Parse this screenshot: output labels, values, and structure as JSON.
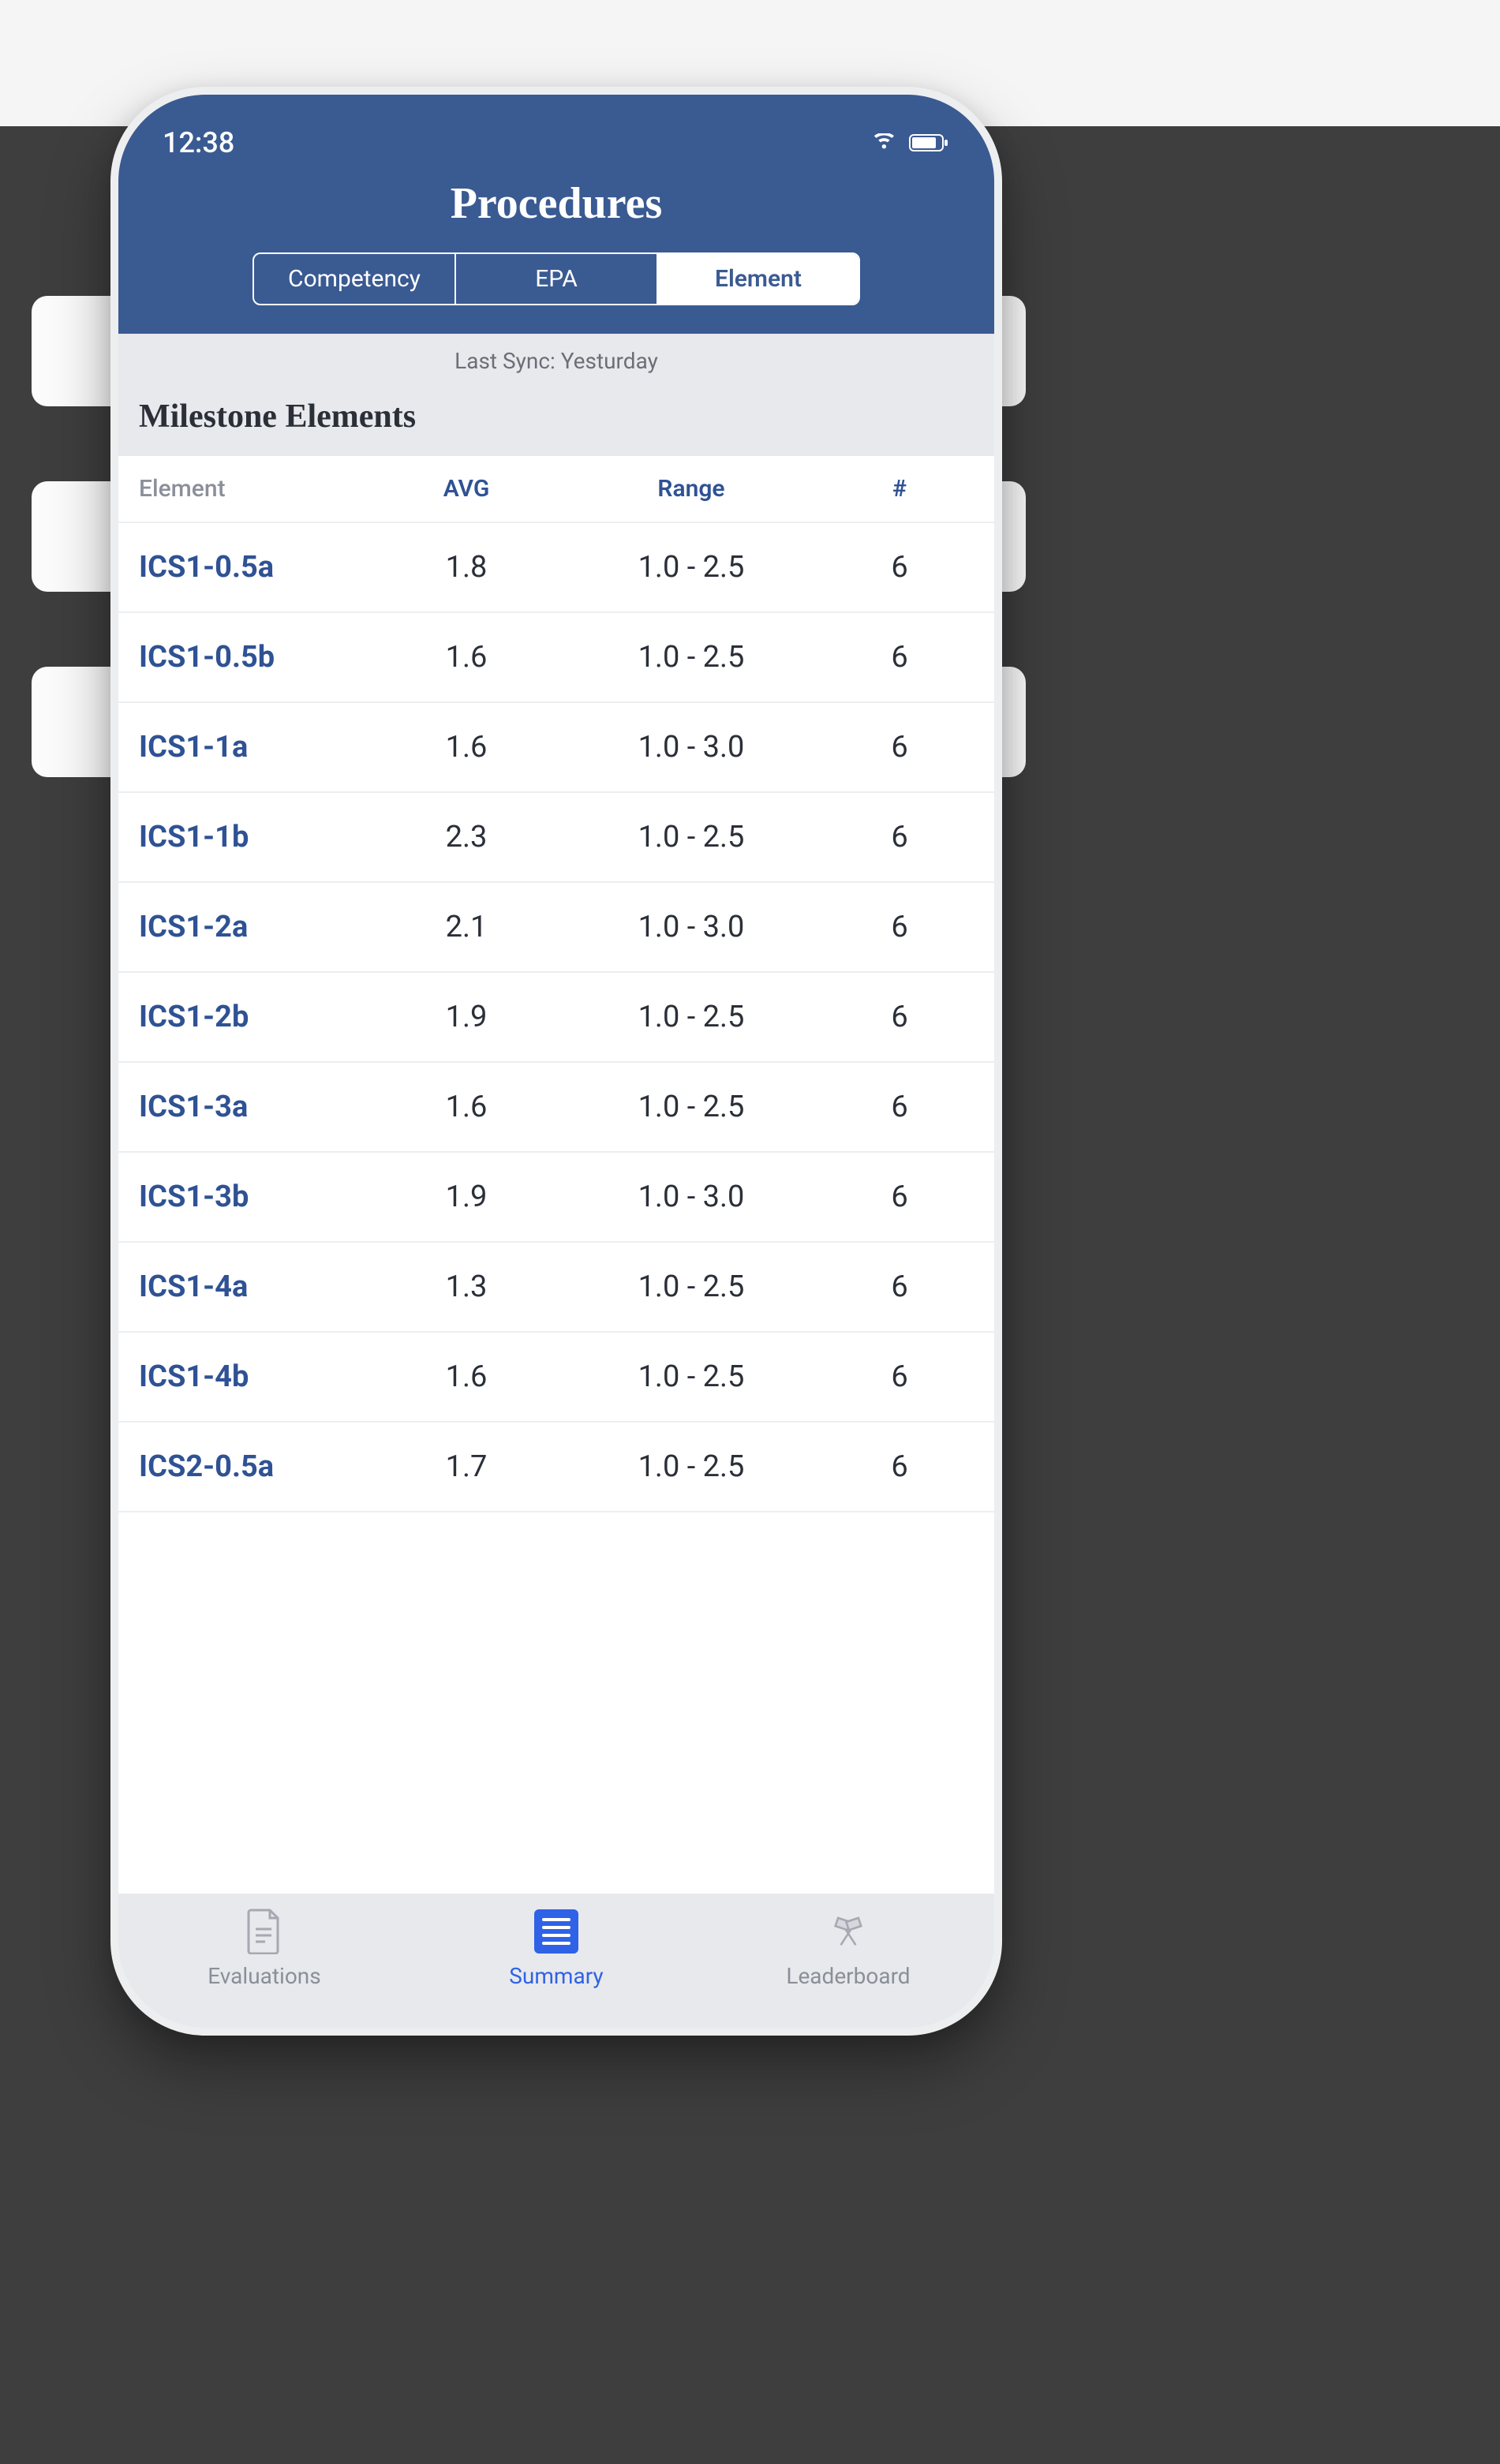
{
  "status": {
    "time": "12:38"
  },
  "header": {
    "title": "Procedures",
    "tabs": {
      "competency": "Competency",
      "epa": "EPA",
      "element": "Element"
    }
  },
  "sync": {
    "label": "Last Sync: Yesturday"
  },
  "section": {
    "title": "Milestone Elements"
  },
  "table": {
    "headers": {
      "element": "Element",
      "avg": "AVG",
      "range": "Range",
      "count": "#"
    },
    "rows": [
      {
        "element": "ICS1-0.5a",
        "avg": "1.8",
        "range": "1.0 - 2.5",
        "count": "6"
      },
      {
        "element": "ICS1-0.5b",
        "avg": "1.6",
        "range": "1.0 - 2.5",
        "count": "6"
      },
      {
        "element": "ICS1-1a",
        "avg": "1.6",
        "range": "1.0 - 3.0",
        "count": "6"
      },
      {
        "element": "ICS1-1b",
        "avg": "2.3",
        "range": "1.0 - 2.5",
        "count": "6"
      },
      {
        "element": "ICS1-2a",
        "avg": "2.1",
        "range": "1.0 - 3.0",
        "count": "6"
      },
      {
        "element": "ICS1-2b",
        "avg": "1.9",
        "range": "1.0 - 2.5",
        "count": "6"
      },
      {
        "element": "ICS1-3a",
        "avg": "1.6",
        "range": "1.0 - 2.5",
        "count": "6"
      },
      {
        "element": "ICS1-3b",
        "avg": "1.9",
        "range": "1.0 - 3.0",
        "count": "6"
      },
      {
        "element": "ICS1-4a",
        "avg": "1.3",
        "range": "1.0 - 2.5",
        "count": "6"
      },
      {
        "element": "ICS1-4b",
        "avg": "1.6",
        "range": "1.0 - 2.5",
        "count": "6"
      },
      {
        "element": "ICS2-0.5a",
        "avg": "1.7",
        "range": "1.0 - 2.5",
        "count": "6"
      }
    ]
  },
  "nav": {
    "evaluations": "Evaluations",
    "summary": "Summary",
    "leaderboard": "Leaderboard"
  }
}
